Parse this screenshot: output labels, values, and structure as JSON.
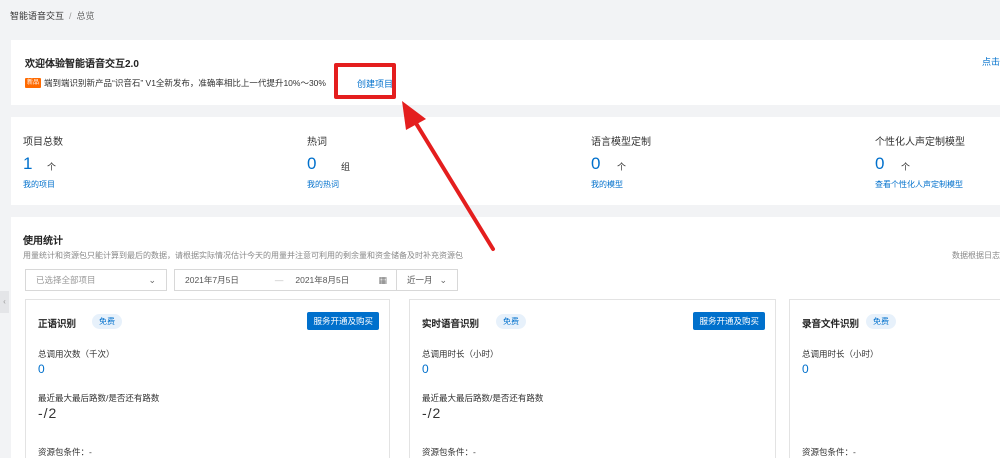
{
  "breadcrumb": {
    "root": "智能语音交互",
    "separator": "/",
    "current": "总览"
  },
  "welcome": {
    "title": "欢迎体验智能语音交互2.0",
    "right_link": "点击",
    "news_tag": "新品",
    "news_text": "端到端识别新产品“识音石” V1全新发布，准确率相比上一代提升10%～30%",
    "create_project": "创建项目"
  },
  "stats": [
    {
      "label": "项目总数",
      "value": "1",
      "unit": "个",
      "link": "我的项目"
    },
    {
      "label": "热词",
      "value": "0",
      "unit": "组",
      "link": "我的热词"
    },
    {
      "label": "语言模型定制",
      "value": "0",
      "unit": "个",
      "link": "我的模型"
    },
    {
      "label": "个性化人声定制模型",
      "value": "0",
      "unit": "个",
      "link": "查看个性化人声定制模型"
    }
  ],
  "usage": {
    "title": "使用统计",
    "desc": "用量统计和资源包只能计算到最后的数据，请根据实际情况估计今天的用量并注意可利用的剩余量和资金储备及时补充资源包",
    "right_note": "数据根据日志",
    "project_select": "已选择全部项目",
    "date_start": "2021年7月5日",
    "date_sep": "—",
    "date_end": "2021年8月5日",
    "range": "近一月"
  },
  "services": [
    {
      "name": "正语识别",
      "free": "免费",
      "buy": "服务开通及购买",
      "m1_label": "总调用次数（千次）",
      "m1_value": "0",
      "m2_label": "最近最大最后路数/是否还有路数",
      "m2_value": "-/2",
      "pkg": "资源包条件：-"
    },
    {
      "name": "实时语音识别",
      "free": "免费",
      "buy": "服务开通及购买",
      "m1_label": "总调用时长（小时）",
      "m1_value": "0",
      "m2_label": "最近最大最后路数/是否还有路数",
      "m2_value": "-/2",
      "pkg": "资源包条件：-"
    },
    {
      "name": "录音文件识别",
      "free": "免费",
      "buy": "",
      "m1_label": "总调用时长（小时）",
      "m1_value": "0",
      "m2_label": "",
      "m2_value": "",
      "pkg": "资源包条件：-"
    }
  ],
  "icons": {
    "chevron": "chevron-down-icon",
    "calendar": "calendar-icon",
    "collapse": "chevron-left-icon"
  },
  "colors": {
    "accent": "#0070cc",
    "new_tag": "#ff6a00",
    "annotation": "#e41e1e"
  }
}
